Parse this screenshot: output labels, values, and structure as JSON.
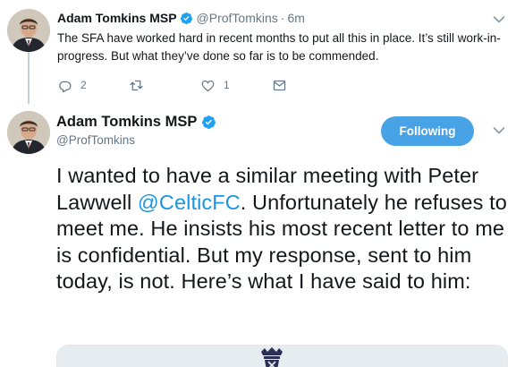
{
  "reply_tweet": {
    "author_name": "Adam Tomkins MSP",
    "handle": "@ProfTomkins",
    "separator": "·",
    "time": "6m",
    "text": "The SFA have worked hard in recent months to put all this in place. It’s still work-in-progress. But what they’ve done so far is to be commended.",
    "reply_count": "2",
    "retweet_count": "",
    "like_count": "1"
  },
  "main_tweet": {
    "author_name": "Adam Tomkins MSP",
    "handle": "@ProfTomkins",
    "follow_label": "Following",
    "text_before_mention": "I wanted to have a similar meeting with Peter Lawwell ",
    "mention": "@CelticFC",
    "text_after_mention": ". Unfortunately he refuses to meet me. He insists his most recent letter to me is confidential. But my response, sent to him today, is not. Here’s what I have said to him:"
  },
  "icons": {
    "verified": "verified-badge-icon",
    "caret": "chevron-down-icon",
    "reply": "reply-icon",
    "retweet": "retweet-icon",
    "like": "heart-icon",
    "message": "direct-message-icon"
  },
  "colors": {
    "accent": "#1b95e0",
    "follow_button": "#48a3e6",
    "secondary_text": "#657786",
    "thread_line": "#c5d1da"
  }
}
